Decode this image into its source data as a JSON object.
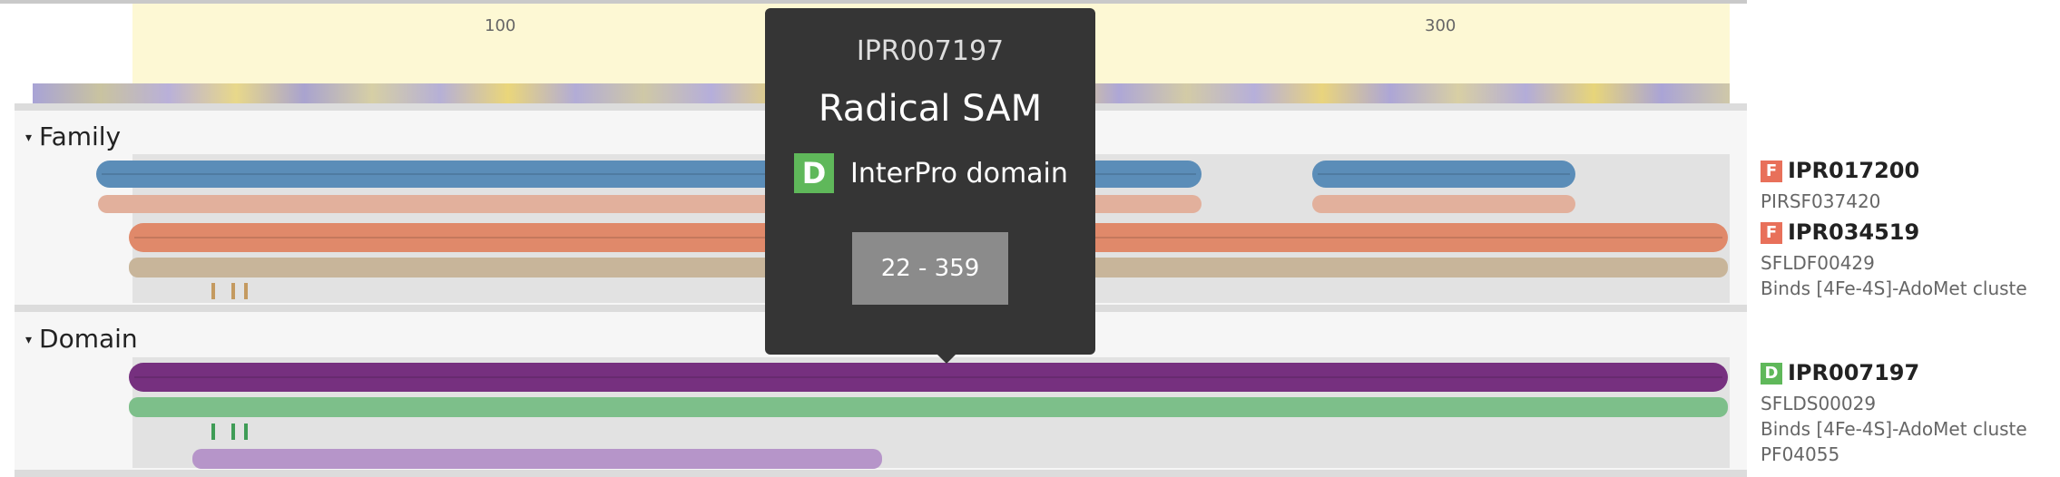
{
  "ruler": {
    "ticks": [
      "100",
      "300"
    ]
  },
  "sections": {
    "family": {
      "title": "Family",
      "caret": "▾"
    },
    "domain": {
      "title": "Domain",
      "caret": "▾"
    }
  },
  "labels": {
    "family": [
      {
        "badge": "F",
        "badge_color": "#e8705a",
        "accession": "IPR017200"
      },
      {
        "text": "PIRSF037420"
      },
      {
        "badge": "F",
        "badge_color": "#e8705a",
        "accession": "IPR034519"
      },
      {
        "text": "SFLDF00429"
      },
      {
        "text": "Binds [4Fe-4S]-AdoMet cluste"
      }
    ],
    "domain": [
      {
        "badge": "D",
        "badge_color": "#5fb85a",
        "accession": "IPR007197"
      },
      {
        "text": "SFLDS00029"
      },
      {
        "text": "Binds [4Fe-4S]-AdoMet cluste"
      },
      {
        "text": "PF04055"
      }
    ]
  },
  "tooltip": {
    "accession": "IPR007197",
    "name": "Radical SAM",
    "type_badge": "D",
    "type_label": "InterPro domain",
    "range": "22 - 359"
  },
  "colors": {
    "blue": "#5b8db8",
    "peach": "#e2b09c",
    "orange": "#e0896a",
    "tan": "#c8b59a",
    "purple": "#76307f",
    "green": "#7dbf8a",
    "lavender": "#b695c9",
    "residue_tan": "#c49a60",
    "residue_green": "#3f9c56"
  }
}
